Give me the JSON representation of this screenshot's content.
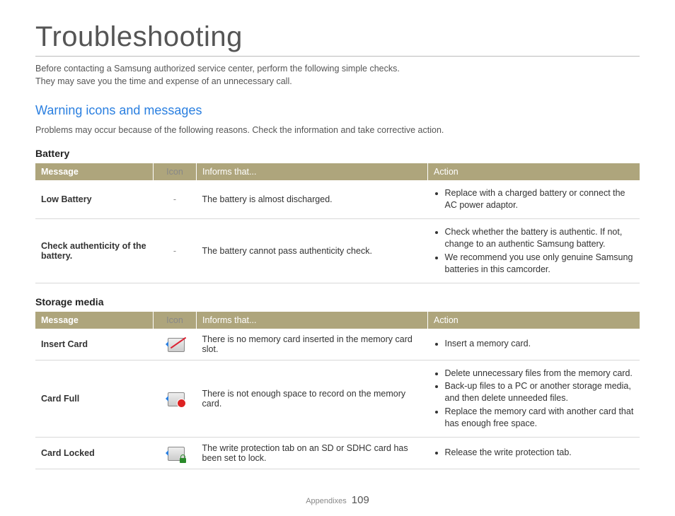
{
  "page": {
    "title": "Troubleshooting",
    "intro_line1": "Before contacting a Samsung authorized service center, perform the following simple checks.",
    "intro_line2": "They may save you the time and expense of an unnecessary call.",
    "footer_section": "Appendixes",
    "footer_page": "109"
  },
  "section": {
    "heading": "Warning icons and messages",
    "sub": "Problems may occur because of the following reasons. Check the information and take corrective action."
  },
  "columns": {
    "message": "Message",
    "icon": "Icon",
    "informs": "Informs that...",
    "action": "Action"
  },
  "battery": {
    "title": "Battery",
    "rows": [
      {
        "message": "Low Battery",
        "icon": "-",
        "informs": "The battery is almost discharged.",
        "actions": [
          "Replace with a charged battery or connect the AC power adaptor."
        ]
      },
      {
        "message": "Check authenticity of the battery.",
        "icon": "-",
        "informs": "The battery cannot pass authenticity check.",
        "actions": [
          "Check whether the battery is authentic. If not, change to an authentic Samsung battery.",
          "We recommend you use only genuine Samsung batteries in this camcorder."
        ]
      }
    ]
  },
  "storage": {
    "title": "Storage media",
    "rows": [
      {
        "message": "Insert Card",
        "icon": "no-card",
        "informs": "There is no memory card inserted in the memory card slot.",
        "actions": [
          "Insert a memory card."
        ]
      },
      {
        "message": "Card Full",
        "icon": "card-full",
        "informs": "There is not enough space to record on the memory card.",
        "actions": [
          "Delete unnecessary files from the memory card.",
          "Back-up files to a PC or another storage media, and then delete unneeded files.",
          "Replace the memory card with another card that has enough free space."
        ]
      },
      {
        "message": "Card Locked",
        "icon": "card-locked",
        "informs": "The write protection tab on an SD or SDHC card has been set to lock.",
        "actions": [
          "Release the write protection tab."
        ]
      }
    ]
  }
}
